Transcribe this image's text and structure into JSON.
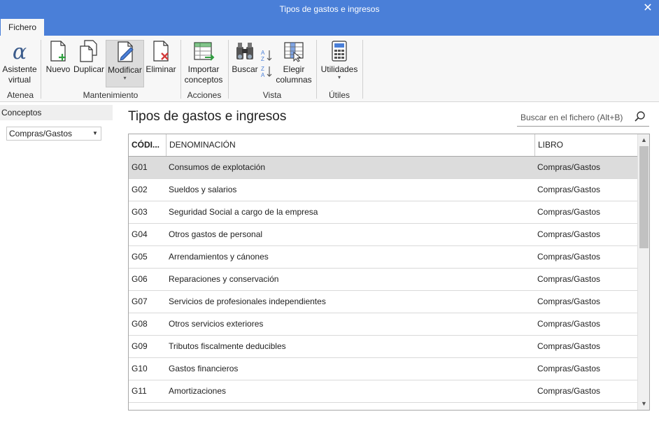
{
  "window": {
    "title": "Tipos de gastos e ingresos",
    "close_glyph": "✕"
  },
  "tabs": [
    {
      "label": "Fichero",
      "active": true
    }
  ],
  "ribbon": {
    "atenea": {
      "label": "Atenea",
      "asistente": "Asistente",
      "virtual": "virtual"
    },
    "mantenimiento": {
      "label": "Mantenimiento",
      "nuevo": "Nuevo",
      "duplicar": "Duplicar",
      "modificar": "Modificar",
      "eliminar": "Eliminar"
    },
    "acciones": {
      "label": "Acciones",
      "importar": "Importar",
      "conceptos": "conceptos"
    },
    "vista": {
      "label": "Vista",
      "buscar": "Buscar",
      "elegir": "Elegir",
      "columnas": "columnas"
    },
    "utiles": {
      "label": "Útiles",
      "utilidades": "Utilidades"
    }
  },
  "sidebar": {
    "header": "Conceptos",
    "combo_value": "Compras/Gastos"
  },
  "main": {
    "title": "Tipos de gastos e ingresos",
    "search_placeholder": "Buscar en el fichero (Alt+B)"
  },
  "grid": {
    "columns": {
      "codigo": "CÓDI...",
      "denominacion": "DENOMINACIÓN",
      "libro": "LIBRO"
    },
    "rows": [
      {
        "codigo": "G01",
        "denominacion": "Consumos de explotación",
        "libro": "Compras/Gastos"
      },
      {
        "codigo": "G02",
        "denominacion": "Sueldos y salarios",
        "libro": "Compras/Gastos"
      },
      {
        "codigo": "G03",
        "denominacion": "Seguridad Social a cargo de la empresa",
        "libro": "Compras/Gastos"
      },
      {
        "codigo": "G04",
        "denominacion": "Otros gastos de personal",
        "libro": "Compras/Gastos"
      },
      {
        "codigo": "G05",
        "denominacion": "Arrendamientos y cánones",
        "libro": "Compras/Gastos"
      },
      {
        "codigo": "G06",
        "denominacion": "Reparaciones y conservación",
        "libro": "Compras/Gastos"
      },
      {
        "codigo": "G07",
        "denominacion": "Servicios de profesionales independientes",
        "libro": "Compras/Gastos"
      },
      {
        "codigo": "G08",
        "denominacion": "Otros servicios exteriores",
        "libro": "Compras/Gastos"
      },
      {
        "codigo": "G09",
        "denominacion": "Tributos fiscalmente deducibles",
        "libro": "Compras/Gastos"
      },
      {
        "codigo": "G10",
        "denominacion": "Gastos financieros",
        "libro": "Compras/Gastos"
      },
      {
        "codigo": "G11",
        "denominacion": "Amortizaciones",
        "libro": "Compras/Gastos"
      }
    ],
    "selected_row": "G01"
  },
  "colors": {
    "titlebar": "#4a7fd8",
    "ribbon": "#f7f7f7",
    "selected_row": "#dcdcdc",
    "accent_green": "#2e9e3e",
    "accent_red": "#d43a3a"
  }
}
